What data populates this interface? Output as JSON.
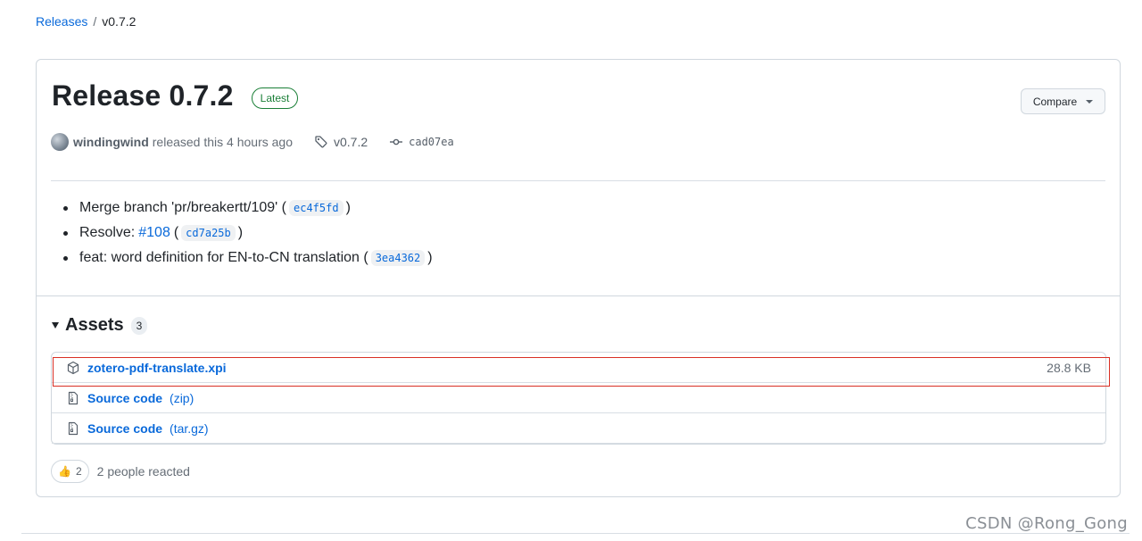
{
  "breadcrumb": {
    "releases_link": "Releases",
    "separator": "/",
    "current": "v0.7.2"
  },
  "release": {
    "title": "Release 0.7.2",
    "badge": "Latest",
    "compare_label": "Compare",
    "author": "windingwind",
    "released_text": "released this 4 hours ago",
    "tag": "v0.7.2",
    "commit": "cad07ea"
  },
  "notes": [
    {
      "text": "Merge branch 'pr/breakertt/109' (",
      "code": "ec4f5fd",
      "after": ")"
    },
    {
      "text": "Resolve:",
      "issue": "#108",
      "paren_open": "(",
      "code": "cd7a25b",
      "after": ")"
    },
    {
      "text": "feat: word definition for EN-to-CN translation (",
      "code": "3ea4362",
      "after": ")"
    }
  ],
  "assets": {
    "title": "Assets",
    "count": "3",
    "items": [
      {
        "name": "zotero-pdf-translate.xpi",
        "suffix": "",
        "size": "28.8 KB",
        "icon": "package-icon"
      },
      {
        "name": "Source code",
        "suffix": "(zip)",
        "size": "",
        "icon": "file-zip-icon"
      },
      {
        "name": "Source code",
        "suffix": "(tar.gz)",
        "size": "",
        "icon": "file-zip-icon"
      }
    ]
  },
  "reactions": {
    "emoji": "👍",
    "count": "2",
    "text": "2 people reacted"
  },
  "watermark": "CSDN @Rong_Gong",
  "colors": {
    "link": "#0969da",
    "latest_badge": "#1a7f37",
    "highlight_box": "#d93025"
  }
}
